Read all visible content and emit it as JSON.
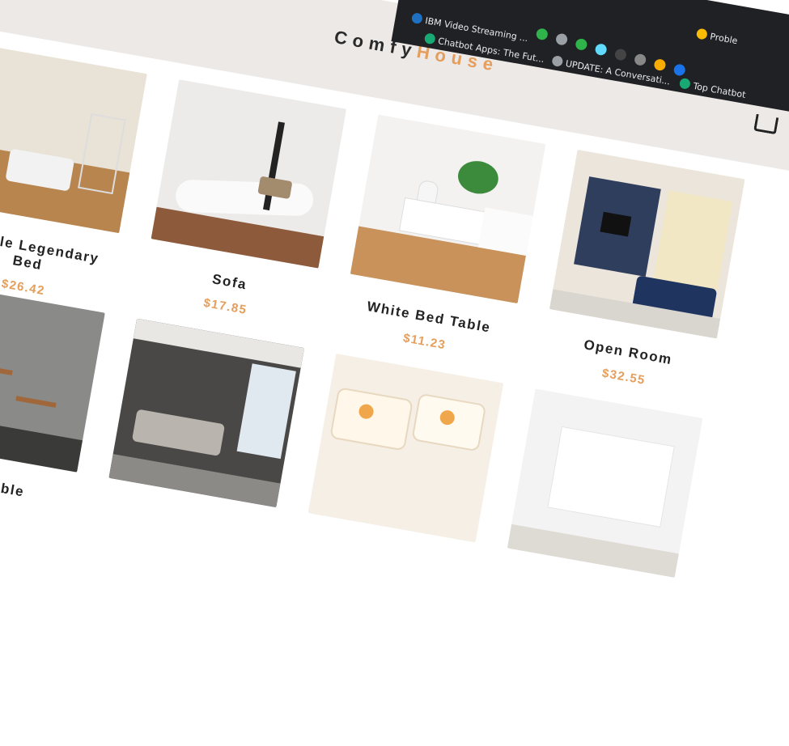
{
  "brand": {
    "part1": "Comfy",
    "part2": "House",
    "accent_color": "#e59e5b"
  },
  "bookmarks": [
    {
      "label": "IBM Video Streaming ...",
      "icon": "ibm-icon"
    },
    {
      "label": "Chatbot Apps: The Fut...",
      "icon": "chatbot-icon"
    },
    {
      "label": "UPDATE: A Conversati...",
      "icon": "globe-icon"
    },
    {
      "label": "Top Chatbot",
      "icon": "chatbot-icon"
    },
    {
      "label": "Proble",
      "icon": "warning-icon"
    }
  ],
  "products": [
    {
      "name": "Simple Legendary Bed",
      "price": "$26.42"
    },
    {
      "name": "Sofa",
      "price": "$17.85"
    },
    {
      "name": "White Bed Table",
      "price": "$11.23"
    },
    {
      "name": "Open Room",
      "price": "$32.55"
    },
    {
      "name": "Old Table",
      "price": ""
    },
    {
      "name": "",
      "price": ""
    },
    {
      "name": "",
      "price": ""
    },
    {
      "name": "",
      "price": ""
    }
  ]
}
